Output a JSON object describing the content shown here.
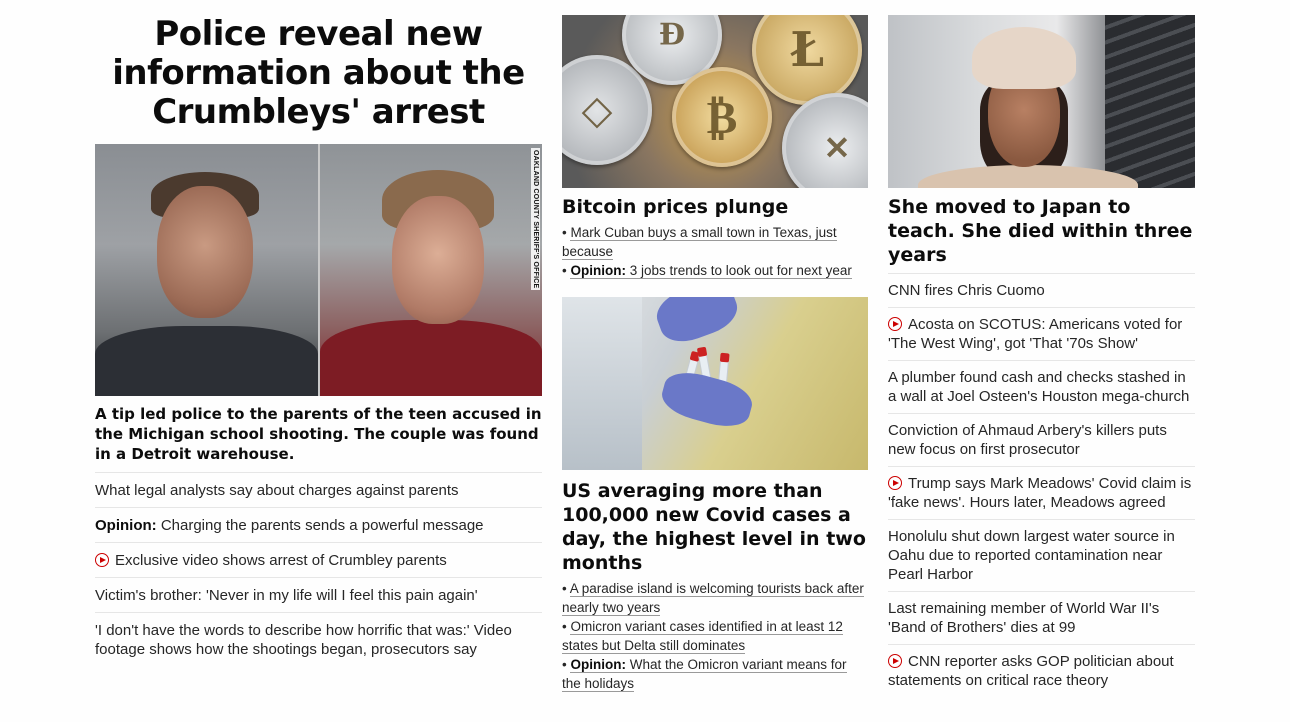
{
  "col1": {
    "headline": "Police reveal new information about the Crumbleys' arrest",
    "image_credit": "OAKLAND COUNTY SHERIFF'S OFFICE",
    "summary": "A tip led police to the parents of the teen accused in the Michigan school shooting. The couple was found in a Detroit warehouse.",
    "links": [
      {
        "text": "What legal analysts say about charges against parents"
      },
      {
        "prefix": "Opinion:",
        "text": " Charging the parents sends a powerful message"
      },
      {
        "video": true,
        "text": "Exclusive video shows arrest of Crumbley parents"
      },
      {
        "text": "Victim's brother: 'Never in my life will I feel this pain again'"
      },
      {
        "text": "'I don't have the words to describe how horrific that was:' Video footage shows how the shootings began, prosecutors say"
      }
    ]
  },
  "col2": {
    "story1": {
      "headline": "Bitcoin prices plunge",
      "bullets": [
        {
          "text": "Mark Cuban buys a small town in Texas, just because"
        },
        {
          "prefix": "Opinion:",
          "text": " 3 jobs trends to look out for next year"
        }
      ]
    },
    "story2": {
      "headline": "US averaging more than 100,000 new Covid cases a day, the highest level in two months",
      "bullets": [
        {
          "text": "A paradise island is welcoming tourists back after nearly two years"
        },
        {
          "text": "Omicron variant cases identified in at least 12 states but Delta still dominates"
        },
        {
          "prefix": "Opinion:",
          "text": " What the Omicron variant means for the holidays"
        }
      ]
    }
  },
  "col3": {
    "headline": "She moved to Japan to teach. She died within three years",
    "links": [
      {
        "text": "CNN fires Chris Cuomo"
      },
      {
        "video": true,
        "text": "Acosta on SCOTUS: Americans voted for 'The West Wing', got 'That '70s Show'"
      },
      {
        "text": "A plumber found cash and checks stashed in a wall at Joel Osteen's Houston mega-church"
      },
      {
        "text": "Conviction of Ahmaud Arbery's killers puts new focus on first prosecutor"
      },
      {
        "video": true,
        "text": "Trump says Mark Meadows' Covid claim is 'fake news'. Hours later, Meadows agreed"
      },
      {
        "text": "Honolulu shut down largest water source in Oahu due to reported contamination near Pearl Harbor"
      },
      {
        "text": "Last remaining member of World War II's 'Band of Brothers' dies at 99"
      },
      {
        "video": true,
        "text": "CNN reporter asks GOP politician about statements on critical race theory"
      }
    ]
  },
  "colors": {
    "video_icon": "#cc0000",
    "divider": "#e6e6e6",
    "text": "#262626"
  }
}
